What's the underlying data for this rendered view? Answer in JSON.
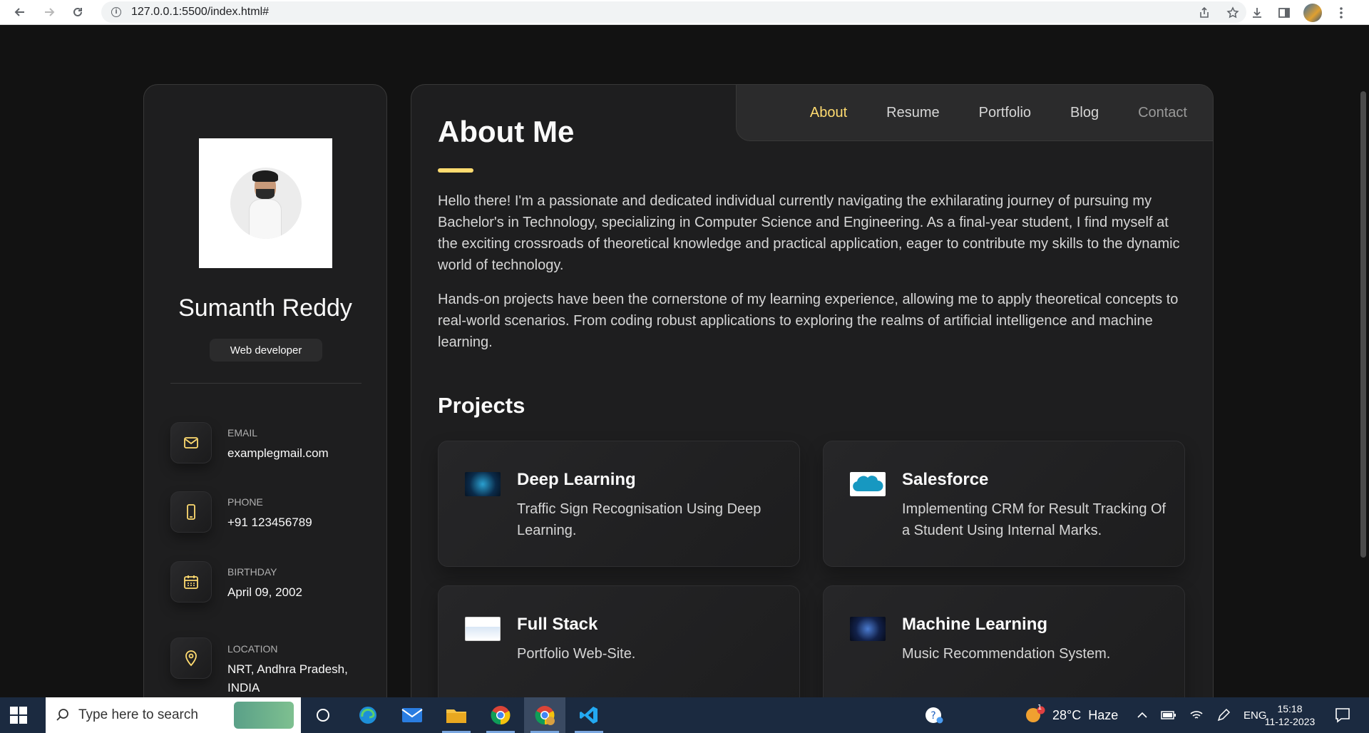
{
  "browser": {
    "url": "127.0.0.1:5500/index.html#"
  },
  "profile": {
    "name": "Sumanth Reddy",
    "role": "Web developer",
    "contacts": [
      {
        "label": "EMAIL",
        "value": "examplegmail.com",
        "icon": "mail-icon"
      },
      {
        "label": "PHONE",
        "value": "+91 123456789",
        "icon": "phone-icon"
      },
      {
        "label": "BIRTHDAY",
        "value": "April 09, 2002",
        "icon": "calendar-icon"
      },
      {
        "label": "LOCATION",
        "value": "NRT, Andhra Pradesh, INDIA",
        "icon": "location-pin-icon"
      }
    ]
  },
  "nav": {
    "items": [
      "About",
      "Resume",
      "Portfolio",
      "Blog",
      "Contact"
    ],
    "active": "About"
  },
  "about": {
    "title": "About Me",
    "paragraphs": [
      "Hello there! I'm a passionate and dedicated individual currently navigating the exhilarating journey of pursuing my Bachelor's in Technology, specializing in Computer Science and Engineering. As a final-year student, I find myself at the exciting crossroads of theoretical knowledge and practical application, eager to contribute my skills to the dynamic world of technology.",
      "Hands-on projects have been the cornerstone of my learning experience, allowing me to apply theoretical concepts to real-world scenarios. From coding robust applications to exploring the realms of artificial intelligence and machine learning."
    ]
  },
  "projects": {
    "title": "Projects",
    "items": [
      {
        "title": "Deep Learning",
        "desc": "Traffic Sign Recognisation Using Deep Learning."
      },
      {
        "title": "Salesforce",
        "desc": "Implementing CRM for Result Tracking Of a Student Using Internal Marks."
      },
      {
        "title": "Full Stack",
        "desc": "Portfolio Web-Site."
      },
      {
        "title": "Machine Learning",
        "desc": "Music Recommendation System."
      }
    ]
  },
  "taskbar": {
    "search_placeholder": "Type here to search",
    "weather": "28°C  Haze",
    "language": "ENG",
    "time": "15:18",
    "date": "11-12-2023",
    "weather_badge": "1"
  },
  "colors": {
    "accent": "#ffdb70",
    "background": "#121212",
    "panel": "#1e1e1f"
  }
}
